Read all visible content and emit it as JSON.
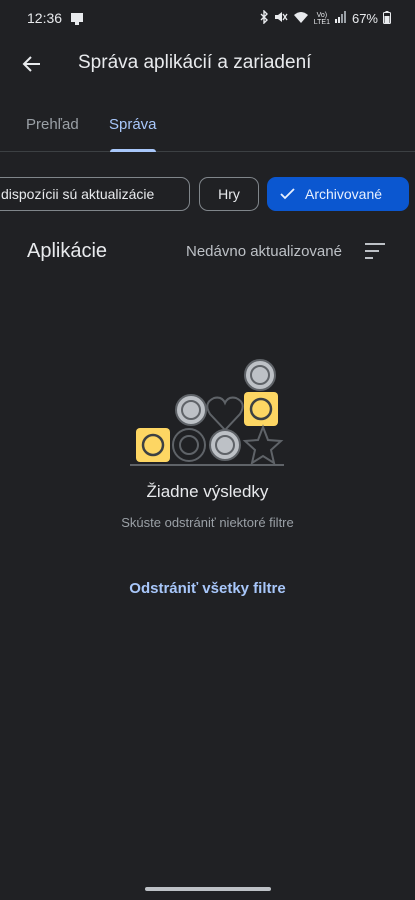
{
  "status_bar": {
    "time": "12:36",
    "volte_top": "Vo)",
    "volte_bottom": "LTE1",
    "battery": "67%",
    "icons": [
      "notification-icon",
      "bluetooth-icon",
      "mute-icon",
      "wifi-icon",
      "signal-icon",
      "battery-icon"
    ]
  },
  "app_bar": {
    "title": "Správa aplikácií a zariadení",
    "back_icon": "arrow-back-icon"
  },
  "tabs": [
    {
      "label": "Prehľad",
      "active": false
    },
    {
      "label": "Správa",
      "active": true
    }
  ],
  "filters": [
    {
      "label": "K dispozícii sú aktualizácie",
      "visible_label": "dispozícii sú aktualizácie",
      "selected": false
    },
    {
      "label": "Hry",
      "selected": false
    },
    {
      "label": "Archivované",
      "selected": true
    }
  ],
  "section": {
    "title": "Aplikácie",
    "sort_label": "Nedávno aktualizované",
    "sort_icon": "sort-icon"
  },
  "empty_state": {
    "title": "Žiadne výsledky",
    "subtitle": "Skúste odstrániť niektoré filtre",
    "action": "Odstrániť všetky filtre"
  },
  "colors": {
    "background": "#202124",
    "accent": "#a8c7fa",
    "selected_chip": "#0b57d0",
    "illustration_yellow": "#fdd663",
    "illustration_grey": "#bdc1c6"
  }
}
